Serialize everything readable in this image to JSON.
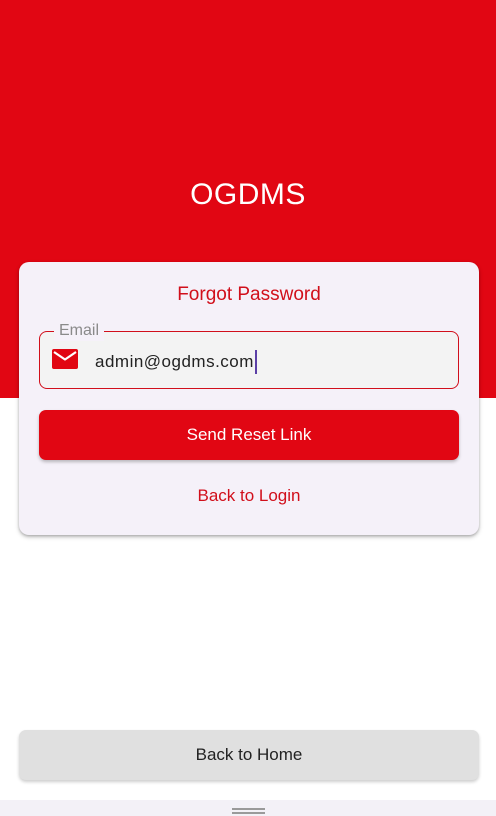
{
  "app": {
    "title": "OGDMS"
  },
  "card": {
    "title": "Forgot Password",
    "email_field": {
      "label": "Email",
      "value": "admin@ogdms.com",
      "icon": "mail-icon"
    },
    "send_button_label": "Send Reset Link",
    "back_to_login_label": "Back to Login"
  },
  "footer": {
    "back_home_label": "Back to Home"
  },
  "colors": {
    "brand_red": "#e10613",
    "accent_text_red": "#d10f1b",
    "card_background": "#f5f1f9",
    "secondary_button": "#e0e0e0",
    "caret": "#5b3fa6"
  }
}
